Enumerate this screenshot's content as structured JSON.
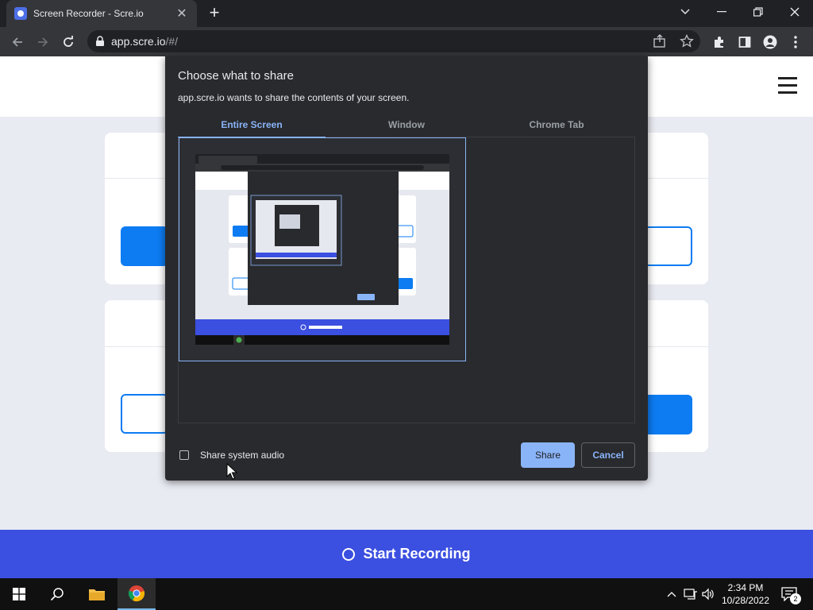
{
  "browser": {
    "tab_title": "Screen Recorder - Scre.io",
    "url_host": "app.scre.io",
    "url_path": "/#/"
  },
  "dialog": {
    "title": "Choose what to share",
    "subtitle": "app.scre.io wants to share the contents of your screen.",
    "tabs": [
      "Entire Screen",
      "Window",
      "Chrome Tab"
    ],
    "active_tab": "Entire Screen",
    "audio_label": "Share system audio",
    "audio_checked": false,
    "share_label": "Share",
    "cancel_label": "Cancel"
  },
  "page": {
    "start_label": "Start Recording"
  },
  "taskbar": {
    "time": "2:34 PM",
    "date": "10/28/2022",
    "notification_count": "2"
  },
  "colors": {
    "accent_blue": "#0d7cf2",
    "start_bar": "#3b4fe0",
    "dialog_bg": "#292a2d",
    "dialog_accent": "#8ab4f8"
  }
}
